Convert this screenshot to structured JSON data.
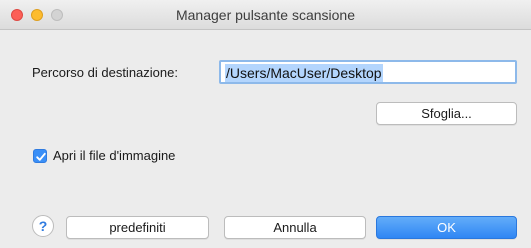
{
  "window": {
    "title": "Manager pulsante scansione"
  },
  "destination": {
    "label": "Percorso di destinazione:",
    "value": "/Users/MacUser/Desktop"
  },
  "buttons": {
    "browse": "Sfoglia...",
    "defaults": "predefiniti",
    "cancel": "Annulla",
    "ok": "OK",
    "help": "?"
  },
  "open_image": {
    "label": "Apri il file d'immagine",
    "checked": true
  },
  "colors": {
    "accent": "#3a8ff7",
    "close": "#fc5f57",
    "minimize": "#fdbc2e",
    "zoom_disabled": "#d3d3d3",
    "selection": "#b3d5fd"
  }
}
